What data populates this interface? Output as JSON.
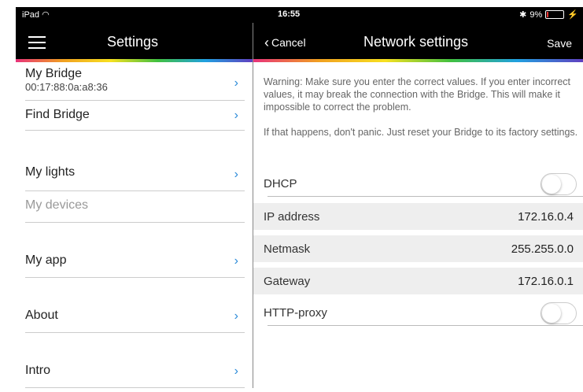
{
  "status_bar": {
    "device": "iPad",
    "time": "16:55",
    "battery": "9%"
  },
  "left_nav": {
    "title": "Settings"
  },
  "menu": {
    "my_bridge": "My Bridge",
    "bridge_id": "00:17:88:0a:a8:36",
    "find_bridge": "Find Bridge",
    "my_lights": "My lights",
    "my_devices": "My devices",
    "my_app": "My app",
    "about": "About",
    "intro": "Intro"
  },
  "right_nav": {
    "cancel": "Cancel",
    "title": "Network settings",
    "save": "Save"
  },
  "warning": {
    "text1": "Warning: Make sure you enter the correct values. If you enter incorrect values, it may break the connection with the Bridge. This will make it impossible to correct the problem.",
    "text2": "If that happens, don't panic. Just reset your Bridge to its factory settings."
  },
  "fields": {
    "dhcp": {
      "label": "DHCP",
      "enabled": false
    },
    "ip": {
      "label": "IP address",
      "value": "172.16.0.4"
    },
    "netmask": {
      "label": "Netmask",
      "value": "255.255.0.0"
    },
    "gateway": {
      "label": "Gateway",
      "value": "172.16.0.1"
    },
    "proxy": {
      "label": "HTTP-proxy",
      "enabled": false
    }
  },
  "colors": {
    "accent": "#2a8ad8",
    "nav_bg": "#000000"
  }
}
